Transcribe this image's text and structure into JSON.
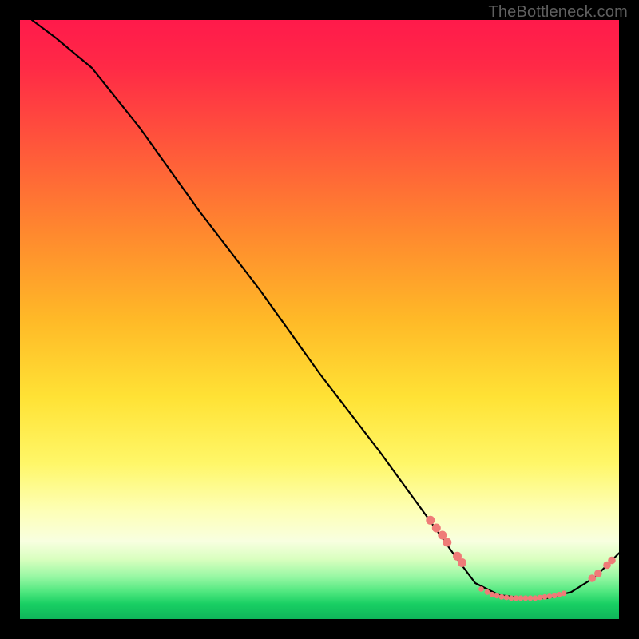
{
  "watermark": "TheBottleneck.com",
  "colors": {
    "curve": "#000000",
    "dot": "#ef7b78",
    "green_label": "#0aa54f"
  },
  "chart_data": {
    "type": "line",
    "title": "",
    "xlabel": "",
    "ylabel": "",
    "xlim": [
      0,
      100
    ],
    "ylim": [
      0,
      100
    ],
    "curve": [
      {
        "x": 2,
        "y": 100
      },
      {
        "x": 6,
        "y": 97
      },
      {
        "x": 12,
        "y": 92
      },
      {
        "x": 20,
        "y": 82
      },
      {
        "x": 30,
        "y": 68
      },
      {
        "x": 40,
        "y": 55
      },
      {
        "x": 50,
        "y": 41
      },
      {
        "x": 60,
        "y": 28
      },
      {
        "x": 68,
        "y": 17
      },
      {
        "x": 73,
        "y": 10
      },
      {
        "x": 76,
        "y": 6
      },
      {
        "x": 80,
        "y": 4
      },
      {
        "x": 84,
        "y": 3.5
      },
      {
        "x": 88,
        "y": 3.5
      },
      {
        "x": 92,
        "y": 4.5
      },
      {
        "x": 96,
        "y": 7
      },
      {
        "x": 98,
        "y": 9
      },
      {
        "x": 100,
        "y": 11
      }
    ],
    "dots_descending": [
      {
        "x": 68.5,
        "y": 16.5
      },
      {
        "x": 69.5,
        "y": 15.2
      },
      {
        "x": 70.5,
        "y": 14.0
      },
      {
        "x": 71.3,
        "y": 12.8
      },
      {
        "x": 73.0,
        "y": 10.5
      },
      {
        "x": 73.8,
        "y": 9.4
      }
    ],
    "dots_flat": [
      {
        "x": 77.0,
        "y": 5.0
      },
      {
        "x": 78.0,
        "y": 4.5
      },
      {
        "x": 78.8,
        "y": 4.1
      },
      {
        "x": 79.6,
        "y": 3.9
      },
      {
        "x": 80.4,
        "y": 3.7
      },
      {
        "x": 81.2,
        "y": 3.6
      },
      {
        "x": 82.0,
        "y": 3.5
      },
      {
        "x": 82.8,
        "y": 3.5
      },
      {
        "x": 83.6,
        "y": 3.5
      },
      {
        "x": 84.4,
        "y": 3.5
      },
      {
        "x": 85.2,
        "y": 3.5
      },
      {
        "x": 86.0,
        "y": 3.5
      },
      {
        "x": 86.8,
        "y": 3.6
      },
      {
        "x": 87.6,
        "y": 3.7
      },
      {
        "x": 88.4,
        "y": 3.8
      },
      {
        "x": 89.2,
        "y": 3.9
      },
      {
        "x": 90.0,
        "y": 4.1
      },
      {
        "x": 90.8,
        "y": 4.3
      }
    ],
    "dots_rising": [
      {
        "x": 95.5,
        "y": 6.8
      },
      {
        "x": 96.5,
        "y": 7.6
      },
      {
        "x": 98.0,
        "y": 9.0
      },
      {
        "x": 98.8,
        "y": 9.8
      }
    ]
  }
}
